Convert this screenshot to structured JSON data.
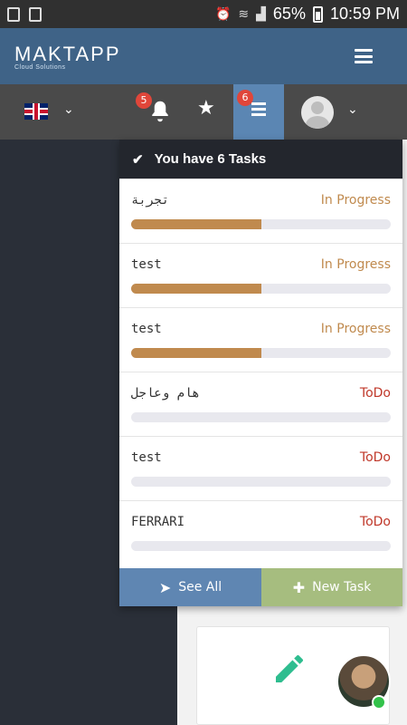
{
  "status_bar": {
    "battery": "65%",
    "time": "10:59 PM"
  },
  "header": {
    "logo_text": "MAKTAPP",
    "logo_tagline": "Cloud Solutions"
  },
  "toolbar": {
    "language_flag": "uk-flag",
    "notifications_count": "5",
    "tasks_count": "6"
  },
  "tasks_dropdown": {
    "header": "You have 6 Tasks",
    "tasks": [
      {
        "title": "تجربة",
        "status": "In Progress",
        "progress": 0.5
      },
      {
        "title": "test",
        "status": "In Progress",
        "progress": 0.5
      },
      {
        "title": "test",
        "status": "In Progress",
        "progress": 0.5
      },
      {
        "title": "هام وعاجل",
        "status": "ToDo",
        "progress": 0
      },
      {
        "title": "test",
        "status": "ToDo",
        "progress": 0
      },
      {
        "title": "FERRARI",
        "status": "ToDo",
        "progress": 0
      }
    ],
    "see_all_label": "See All",
    "new_task_label": "New Task"
  },
  "colors": {
    "header_bg": "#3f6387",
    "in_progress": "#c08a4e",
    "todo": "#c0392b",
    "see_all_bg": "#5f86b2",
    "new_task_bg": "#a6bd7f"
  }
}
